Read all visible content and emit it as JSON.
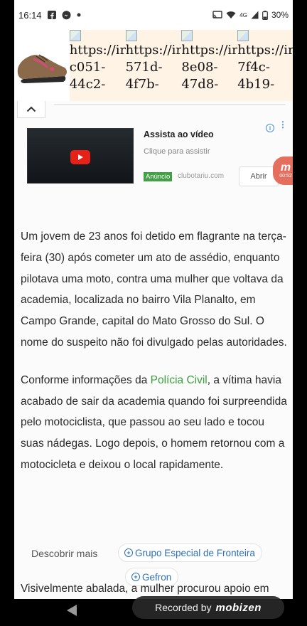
{
  "status_bar": {
    "time": "16:14",
    "signal_label": "4G",
    "battery": "30%",
    "left_icons": [
      "facebook-icon",
      "messenger-icon",
      "dot-icon"
    ],
    "right_icons": [
      "cast-icon",
      "wifi-icon",
      "signal-icon",
      "battery-icon"
    ]
  },
  "product_strip": {
    "images": [
      {
        "alt_line1": "https://ir",
        "alt_line2": "c051-",
        "alt_line3": "44c2-"
      },
      {
        "alt_line1": "https://ir",
        "alt_line2": "571d-",
        "alt_line3": "4f7b-"
      },
      {
        "alt_line1": "https://ir",
        "alt_line2": "8e08-",
        "alt_line3": "47d8-"
      },
      {
        "alt_line1": "https://ir",
        "alt_line2": "7f4c-",
        "alt_line3": "4b19-"
      }
    ]
  },
  "ad": {
    "title": "Assista ao vídeo",
    "subtitle": "Clique para assistir",
    "badge": "Anúncio",
    "domain": "clubotariu.com",
    "open_button": "Abrir",
    "float_badge_text": "00:52"
  },
  "article": {
    "paragraph1": "Um jovem de 23 anos foi detido em flagrante na terça-feira (30) após cometer um ato de assédio, enquanto pilotava uma moto, contra uma mulher que voltava da academia, localizada no bairro Vila Planalto, em Campo Grande, capital do Mato Grosso do Sul. O nome do suspeito não foi divulgado pelas autoridades.",
    "paragraph2_before": "Conforme informações da ",
    "paragraph2_link": "Polícia Civil",
    "paragraph2_after": ", a vítima havia acabado de sair da academia quando foi surpreendida pelo motociclista, que passou ao seu lado e tocou suas nádegas. Logo depois, o homem retornou com a motocicleta e deixou o local rapidamente.",
    "paragraph3_start": "Visivelmente abalada, a mulher procurou apoio em"
  },
  "discover": {
    "label": "Descobrir mais",
    "chips": [
      "Grupo Especial de Fronteira",
      "Gefron"
    ]
  },
  "recorder": {
    "label": "Recorded by",
    "brand": "mobizen"
  },
  "colors": {
    "link_green": "#3aa03a",
    "chip_blue": "#2e6fb7",
    "ad_badge_green": "#43a047"
  }
}
